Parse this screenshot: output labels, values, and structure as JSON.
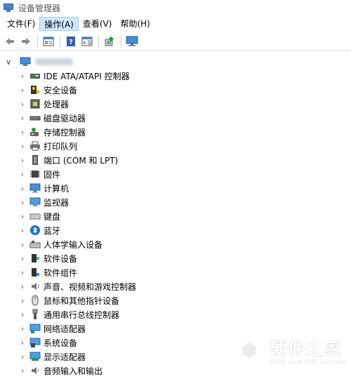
{
  "window": {
    "title": "设备管理器"
  },
  "menu": [
    {
      "label": "文件(F)",
      "active": false
    },
    {
      "label": "操作(A)",
      "active": true
    },
    {
      "label": "查看(V)",
      "active": false
    },
    {
      "label": "帮助(H)",
      "active": false
    }
  ],
  "toolbar": {
    "buttons": [
      "back-arrow-icon",
      "forward-arrow-icon",
      "properties-icon",
      "help-icon",
      "action-pane-icon",
      "scan-hardware-icon",
      "monitor-icon"
    ]
  },
  "tree": {
    "categories": [
      {
        "label": "IDE ATA/ATAPI 控制器",
        "icon": "ide-controller-icon"
      },
      {
        "label": "安全设备",
        "icon": "security-device-icon"
      },
      {
        "label": "处理器",
        "icon": "processor-icon"
      },
      {
        "label": "磁盘驱动器",
        "icon": "disk-drive-icon"
      },
      {
        "label": "存储控制器",
        "icon": "storage-controller-icon"
      },
      {
        "label": "打印队列",
        "icon": "printer-icon"
      },
      {
        "label": "端口 (COM 和 LPT)",
        "icon": "port-icon"
      },
      {
        "label": "固件",
        "icon": "firmware-icon"
      },
      {
        "label": "计算机",
        "icon": "computer-icon"
      },
      {
        "label": "监视器",
        "icon": "monitor-icon"
      },
      {
        "label": "键盘",
        "icon": "keyboard-icon"
      },
      {
        "label": "蓝牙",
        "icon": "bluetooth-icon"
      },
      {
        "label": "人体学输入设备",
        "icon": "hid-icon"
      },
      {
        "label": "软件设备",
        "icon": "software-device-icon"
      },
      {
        "label": "软件组件",
        "icon": "software-component-icon"
      },
      {
        "label": "声音、视频和游戏控制器",
        "icon": "sound-icon"
      },
      {
        "label": "鼠标和其他指针设备",
        "icon": "mouse-icon"
      },
      {
        "label": "通用串行总线控制器",
        "icon": "usb-icon"
      },
      {
        "label": "网络适配器",
        "icon": "network-adapter-icon"
      },
      {
        "label": "系统设备",
        "icon": "system-device-icon"
      },
      {
        "label": "显示适配器",
        "icon": "display-adapter-icon"
      },
      {
        "label": "音频输入和输出",
        "icon": "audio-io-icon"
      }
    ]
  },
  "watermark": {
    "main": "硬件之家",
    "sub": "YING JIAN ZHI JIA.COM"
  },
  "colors": {
    "menu_active_bg": "#cce8ff",
    "accent_blue": "#1e6fd0"
  }
}
